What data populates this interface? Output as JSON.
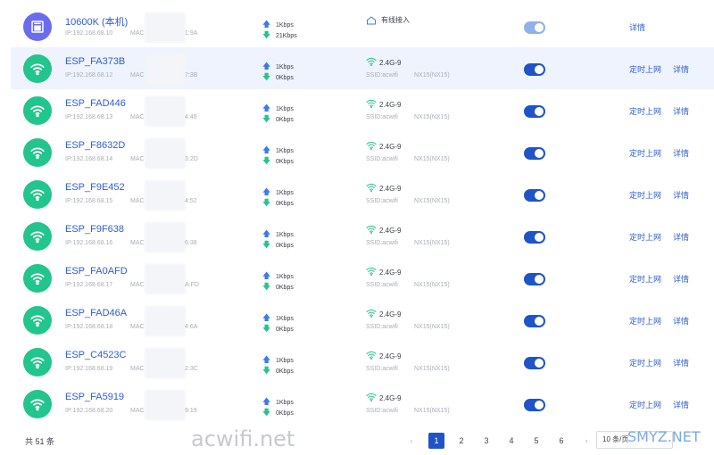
{
  "rows": [
    {
      "type": "pc",
      "name": "10600K (本机)",
      "ip": "IP:192.168.68.10",
      "mac": "MAC",
      "mac_tail": "1:9A",
      "up": "1Kbps",
      "down": "21Kbps",
      "band": "有线接入",
      "ssid": "",
      "model": "",
      "toggle": "light",
      "schedule": "",
      "detail": "详情",
      "highlight": false
    },
    {
      "type": "wifi",
      "name": "ESP_FA373B",
      "ip": "IP:192.168.68.12",
      "mac": "MAC",
      "mac_tail": "7:3B",
      "up": "1Kbps",
      "down": "0Kbps",
      "band": "2.4G-9",
      "ssid": "SSID:acwifi",
      "model": "NX15(NX15)",
      "toggle": "on",
      "schedule": "定时上网",
      "detail": "详情",
      "highlight": true
    },
    {
      "type": "wifi",
      "name": "ESP_FAD446",
      "ip": "IP:192.168.68.13",
      "mac": "MAC",
      "mac_tail": "4:46",
      "up": "1Kbps",
      "down": "0Kbps",
      "band": "2.4G-9",
      "ssid": "SSID:acwifi",
      "model": "NX15(NX15)",
      "toggle": "on",
      "schedule": "定时上网",
      "detail": "详情",
      "highlight": false
    },
    {
      "type": "wifi",
      "name": "ESP_F8632D",
      "ip": "IP:192.168.68.14",
      "mac": "MAC",
      "mac_tail": "3:2D",
      "up": "1Kbps",
      "down": "0Kbps",
      "band": "2.4G-9",
      "ssid": "SSID:acwifi",
      "model": "NX15(NX15)",
      "toggle": "on",
      "schedule": "定时上网",
      "detail": "详情",
      "highlight": false
    },
    {
      "type": "wifi",
      "name": "ESP_F9E452",
      "ip": "IP:192.168.68.15",
      "mac": "MAC",
      "mac_tail": "4:52",
      "up": "1Kbps",
      "down": "0Kbps",
      "band": "2.4G-9",
      "ssid": "SSID:acwifi",
      "model": "NX15(NX15)",
      "toggle": "on",
      "schedule": "定时上网",
      "detail": "详情",
      "highlight": false
    },
    {
      "type": "wifi",
      "name": "ESP_F9F638",
      "ip": "IP:192.168.68.16",
      "mac": "MAC",
      "mac_tail": "6:38",
      "up": "1Kbps",
      "down": "0Kbps",
      "band": "2.4G-9",
      "ssid": "SSID:acwifi",
      "model": "NX15(NX15)",
      "toggle": "on",
      "schedule": "定时上网",
      "detail": "详情",
      "highlight": false
    },
    {
      "type": "wifi",
      "name": "ESP_FA0AFD",
      "ip": "IP:192.168.68.17",
      "mac": "MAC",
      "mac_tail": "A:FD",
      "up": "1Kbps",
      "down": "0Kbps",
      "band": "2.4G-9",
      "ssid": "SSID:acwifi",
      "model": "NX15(NX15)",
      "toggle": "on",
      "schedule": "定时上网",
      "detail": "详情",
      "highlight": false
    },
    {
      "type": "wifi",
      "name": "ESP_FAD46A",
      "ip": "IP:192.168.68.18",
      "mac": "MAC",
      "mac_tail": "4:6A",
      "up": "1Kbps",
      "down": "0Kbps",
      "band": "2.4G-9",
      "ssid": "SSID:acwifi",
      "model": "NX15(NX15)",
      "toggle": "on",
      "schedule": "定时上网",
      "detail": "详情",
      "highlight": false
    },
    {
      "type": "wifi",
      "name": "ESP_C4523C",
      "ip": "IP:192.168.68.19",
      "mac": "MAC",
      "mac_tail": "2:3C",
      "up": "1Kbps",
      "down": "0Kbps",
      "band": "2.4G-9",
      "ssid": "SSID:acwifi",
      "model": "NX15(NX15)",
      "toggle": "on",
      "schedule": "定时上网",
      "detail": "详情",
      "highlight": false
    },
    {
      "type": "wifi",
      "name": "ESP_FA5919",
      "ip": "IP:192.168.68.20",
      "mac": "MAC",
      "mac_tail": "9:19",
      "up": "1Kbps",
      "down": "0Kbps",
      "band": "2.4G-9",
      "ssid": "SSID:acwifi",
      "model": "NX15(NX15)",
      "toggle": "on",
      "schedule": "定时上网",
      "detail": "详情",
      "highlight": false
    }
  ],
  "footer": {
    "total": "共 51 条",
    "watermark": "acwifi.net",
    "pages": [
      "1",
      "2",
      "3",
      "4",
      "5",
      "6"
    ],
    "active_page": "1",
    "prev": "‹",
    "next": "›",
    "page_size": "10 条/页",
    "watermark2": "SMYZ.NET"
  },
  "colors": {
    "accent": "#1e54c8",
    "wifi_avatar": "#22c58b",
    "pc_avatar": "#6b6bf0",
    "link": "#2d5ed6"
  }
}
